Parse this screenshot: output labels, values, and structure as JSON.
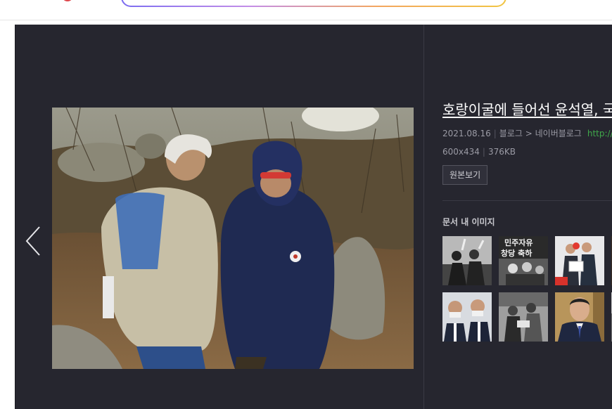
{
  "viewer": {
    "prev_label": "previous-image",
    "title": "호랑이굴에 들어선 윤석열, 국민의힘",
    "date": "2021.08.16",
    "source_type": "블로그",
    "source_arrow": ">",
    "source_name": "네이버블로그",
    "source_url": "http://b",
    "dimensions": "600x434",
    "filesize": "376KB",
    "original_button": "원본보기",
    "related_title": "문서 내 이미지",
    "thumbnail_banner_text": "민주자유\n창당 축하"
  },
  "colors": {
    "viewer_bg": "#26262f",
    "url_green": "#3fa84a",
    "search_gradient": [
      "#7b6cf0",
      "#c38ee8",
      "#f3a65f",
      "#f1c542"
    ]
  }
}
